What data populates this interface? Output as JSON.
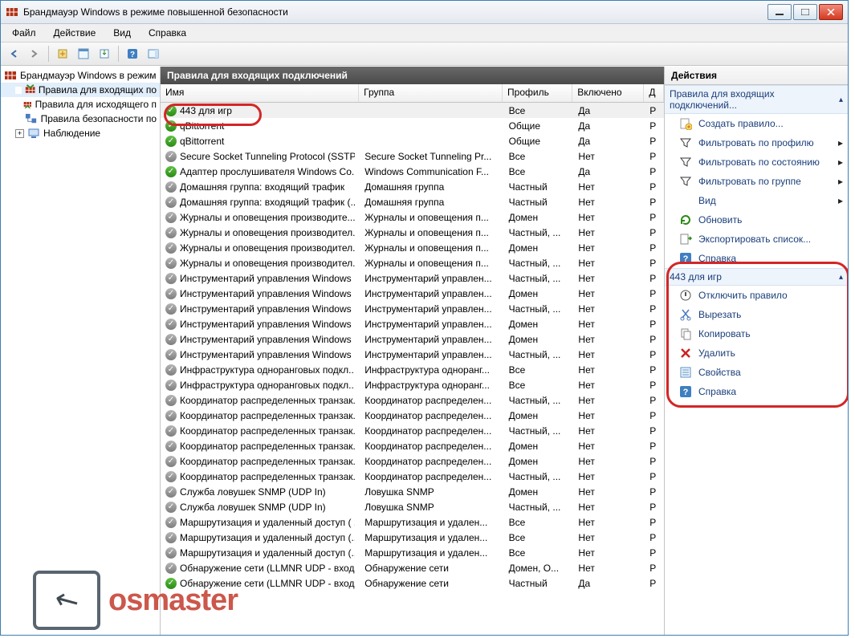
{
  "window": {
    "title": "Брандмауэр Windows в режиме повышенной безопасности"
  },
  "menu": {
    "items": [
      "Файл",
      "Действие",
      "Вид",
      "Справка"
    ]
  },
  "tree": {
    "root": "Брандмауэр Windows в режим",
    "nodes": [
      {
        "label": "Правила для входящих по",
        "icon": "inbound",
        "selected": true
      },
      {
        "label": "Правила для исходящего п",
        "icon": "outbound"
      },
      {
        "label": "Правила безопасности по",
        "icon": "connsec"
      },
      {
        "label": "Наблюдение",
        "icon": "monitoring",
        "expandable": true
      }
    ]
  },
  "list": {
    "title": "Правила для входящих подключений",
    "columns": {
      "name": "Имя",
      "group": "Группа",
      "profile": "Профиль",
      "enabled": "Включено",
      "etc": "Д"
    },
    "rows": [
      {
        "enabled": true,
        "name": "443 для игр",
        "group": "",
        "profile": "Все",
        "en": "Да",
        "selected": true
      },
      {
        "enabled": true,
        "name": "qBittorrent",
        "group": "",
        "profile": "Общие",
        "en": "Да"
      },
      {
        "enabled": true,
        "name": "qBittorrent",
        "group": "",
        "profile": "Общие",
        "en": "Да"
      },
      {
        "enabled": false,
        "name": "Secure Socket Tunneling Protocol (SSTP-...",
        "group": "Secure Socket Tunneling Pr...",
        "profile": "Все",
        "en": "Нет"
      },
      {
        "enabled": true,
        "name": "Адаптер прослушивателя Windows Co...",
        "group": "Windows Communication F...",
        "profile": "Все",
        "en": "Да"
      },
      {
        "enabled": false,
        "name": "Домашняя группа: входящий трафик",
        "group": "Домашняя группа",
        "profile": "Частный",
        "en": "Нет"
      },
      {
        "enabled": false,
        "name": "Домашняя группа: входящий трафик (...",
        "group": "Домашняя группа",
        "profile": "Частный",
        "en": "Нет"
      },
      {
        "enabled": false,
        "name": "Журналы и оповещения производите...",
        "group": "Журналы и оповещения п...",
        "profile": "Домен",
        "en": "Нет"
      },
      {
        "enabled": false,
        "name": "Журналы и оповещения производител...",
        "group": "Журналы и оповещения п...",
        "profile": "Частный, ...",
        "en": "Нет"
      },
      {
        "enabled": false,
        "name": "Журналы и оповещения производител...",
        "group": "Журналы и оповещения п...",
        "profile": "Домен",
        "en": "Нет"
      },
      {
        "enabled": false,
        "name": "Журналы и оповещения производител...",
        "group": "Журналы и оповещения п...",
        "profile": "Частный, ...",
        "en": "Нет"
      },
      {
        "enabled": false,
        "name": "Инструментарий управления Windows ...",
        "group": "Инструментарий управлен...",
        "profile": "Частный, ...",
        "en": "Нет"
      },
      {
        "enabled": false,
        "name": "Инструментарий управления Windows ...",
        "group": "Инструментарий управлен...",
        "profile": "Домен",
        "en": "Нет"
      },
      {
        "enabled": false,
        "name": "Инструментарий управления Windows ...",
        "group": "Инструментарий управлен...",
        "profile": "Частный, ...",
        "en": "Нет"
      },
      {
        "enabled": false,
        "name": "Инструментарий управления Windows ...",
        "group": "Инструментарий управлен...",
        "profile": "Домен",
        "en": "Нет"
      },
      {
        "enabled": false,
        "name": "Инструментарий управления Windows ...",
        "group": "Инструментарий управлен...",
        "profile": "Домен",
        "en": "Нет"
      },
      {
        "enabled": false,
        "name": "Инструментарий управления Windows ...",
        "group": "Инструментарий управлен...",
        "profile": "Частный, ...",
        "en": "Нет"
      },
      {
        "enabled": false,
        "name": "Инфраструктура одноранговых подкл...",
        "group": "Инфраструктура одноранг...",
        "profile": "Все",
        "en": "Нет"
      },
      {
        "enabled": false,
        "name": "Инфраструктура одноранговых подкл...",
        "group": "Инфраструктура одноранг...",
        "profile": "Все",
        "en": "Нет"
      },
      {
        "enabled": false,
        "name": "Координатор распределенных транзак...",
        "group": "Координатор распределен...",
        "profile": "Частный, ...",
        "en": "Нет"
      },
      {
        "enabled": false,
        "name": "Координатор распределенных транзак...",
        "group": "Координатор распределен...",
        "profile": "Домен",
        "en": "Нет"
      },
      {
        "enabled": false,
        "name": "Координатор распределенных транзак...",
        "group": "Координатор распределен...",
        "profile": "Частный, ...",
        "en": "Нет"
      },
      {
        "enabled": false,
        "name": "Координатор распределенных транзак...",
        "group": "Координатор распределен...",
        "profile": "Домен",
        "en": "Нет"
      },
      {
        "enabled": false,
        "name": "Координатор распределенных транзак...",
        "group": "Координатор распределен...",
        "profile": "Домен",
        "en": "Нет"
      },
      {
        "enabled": false,
        "name": "Координатор распределенных транзак...",
        "group": "Координатор распределен...",
        "profile": "Частный, ...",
        "en": "Нет"
      },
      {
        "enabled": false,
        "name": "Служба ловушек SNMP (UDP In)",
        "group": "Ловушка SNMP",
        "profile": "Домен",
        "en": "Нет"
      },
      {
        "enabled": false,
        "name": "Служба ловушек SNMP (UDP In)",
        "group": "Ловушка SNMP",
        "profile": "Частный, ...",
        "en": "Нет"
      },
      {
        "enabled": false,
        "name": "Маршрутизация и удаленный доступ ( ...",
        "group": "Маршрутизация и удален...",
        "profile": "Все",
        "en": "Нет"
      },
      {
        "enabled": false,
        "name": "Маршрутизация и удаленный доступ (...",
        "group": "Маршрутизация и удален...",
        "profile": "Все",
        "en": "Нет"
      },
      {
        "enabled": false,
        "name": "Маршрутизация и удаленный доступ (...",
        "group": "Маршрутизация и удален...",
        "profile": "Все",
        "en": "Нет"
      },
      {
        "enabled": false,
        "name": "Обнаружение сети (LLMNR UDP - входя...",
        "group": "Обнаружение сети",
        "profile": "Домен, О...",
        "en": "Нет"
      },
      {
        "enabled": true,
        "name": "Обнаружение сети (LLMNR UDP - входя...",
        "group": "Обнаружение сети",
        "profile": "Частный",
        "en": "Да"
      }
    ]
  },
  "actions": {
    "header": "Действия",
    "sectionA": {
      "title": "Правила для входящих подключений...",
      "items": [
        {
          "icon": "newrule",
          "label": "Создать правило..."
        },
        {
          "icon": "filter",
          "label": "Фильтровать по профилю",
          "sub": true
        },
        {
          "icon": "filter",
          "label": "Фильтровать по состоянию",
          "sub": true
        },
        {
          "icon": "filter",
          "label": "Фильтровать по группе",
          "sub": true
        },
        {
          "icon": "",
          "label": "Вид",
          "sub": true
        },
        {
          "icon": "refresh",
          "label": "Обновить"
        },
        {
          "icon": "export",
          "label": "Экспортировать список..."
        },
        {
          "icon": "help",
          "label": "Справка"
        }
      ]
    },
    "sectionB": {
      "title": "443 для игр",
      "items": [
        {
          "icon": "disable",
          "label": "Отключить правило"
        },
        {
          "icon": "cut",
          "label": "Вырезать"
        },
        {
          "icon": "copy",
          "label": "Копировать"
        },
        {
          "icon": "delete",
          "label": "Удалить"
        },
        {
          "icon": "props",
          "label": "Свойства"
        },
        {
          "icon": "help",
          "label": "Справка"
        }
      ]
    }
  },
  "watermark": {
    "text": "osmaster"
  }
}
